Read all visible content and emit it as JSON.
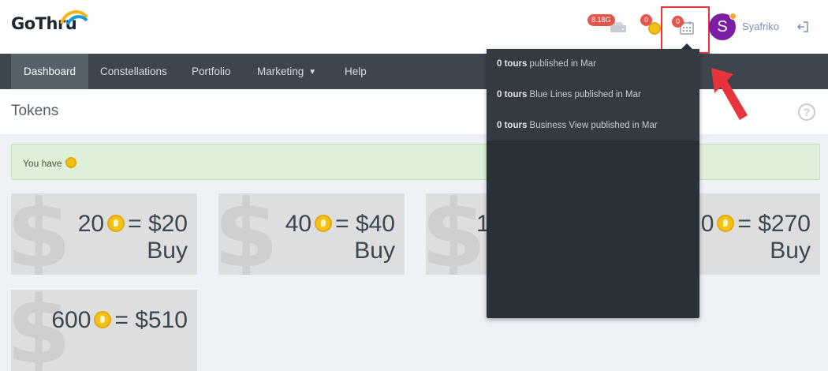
{
  "header": {
    "logo_text": "GoThru",
    "storage_badge": "8.18G",
    "token_badge": "0",
    "calendar_badge": "0",
    "avatar_letter": "S",
    "username": "Syafriko"
  },
  "nav": {
    "items": [
      {
        "label": "Dashboard"
      },
      {
        "label": "Constellations"
      },
      {
        "label": "Portfolio"
      },
      {
        "label": "Marketing"
      },
      {
        "label": "Help"
      }
    ]
  },
  "page": {
    "title": "Tokens",
    "help": "?",
    "alert_text": "You have"
  },
  "packages": [
    {
      "tokens": "20",
      "price": "$20",
      "buy": "Buy"
    },
    {
      "tokens": "40",
      "price": "$40",
      "buy": "Buy"
    },
    {
      "tokens": "1",
      "price": "",
      "buy": ""
    },
    {
      "tokens": "0",
      "price": "$270",
      "buy": "Buy"
    },
    {
      "tokens": "600",
      "price": "$510",
      "buy": ""
    }
  ],
  "dropdown": {
    "items": [
      {
        "count": "0 tours",
        "text": "published in Mar"
      },
      {
        "count": "0 tours",
        "text": "Blue Lines published in Mar"
      },
      {
        "count": "0 tours",
        "text": "Business View published in Mar"
      }
    ]
  },
  "colors": {
    "accent": "#3d454e",
    "badge": "#e2574c",
    "avatar": "#7a1fa3",
    "highlight": "#e8343d"
  }
}
